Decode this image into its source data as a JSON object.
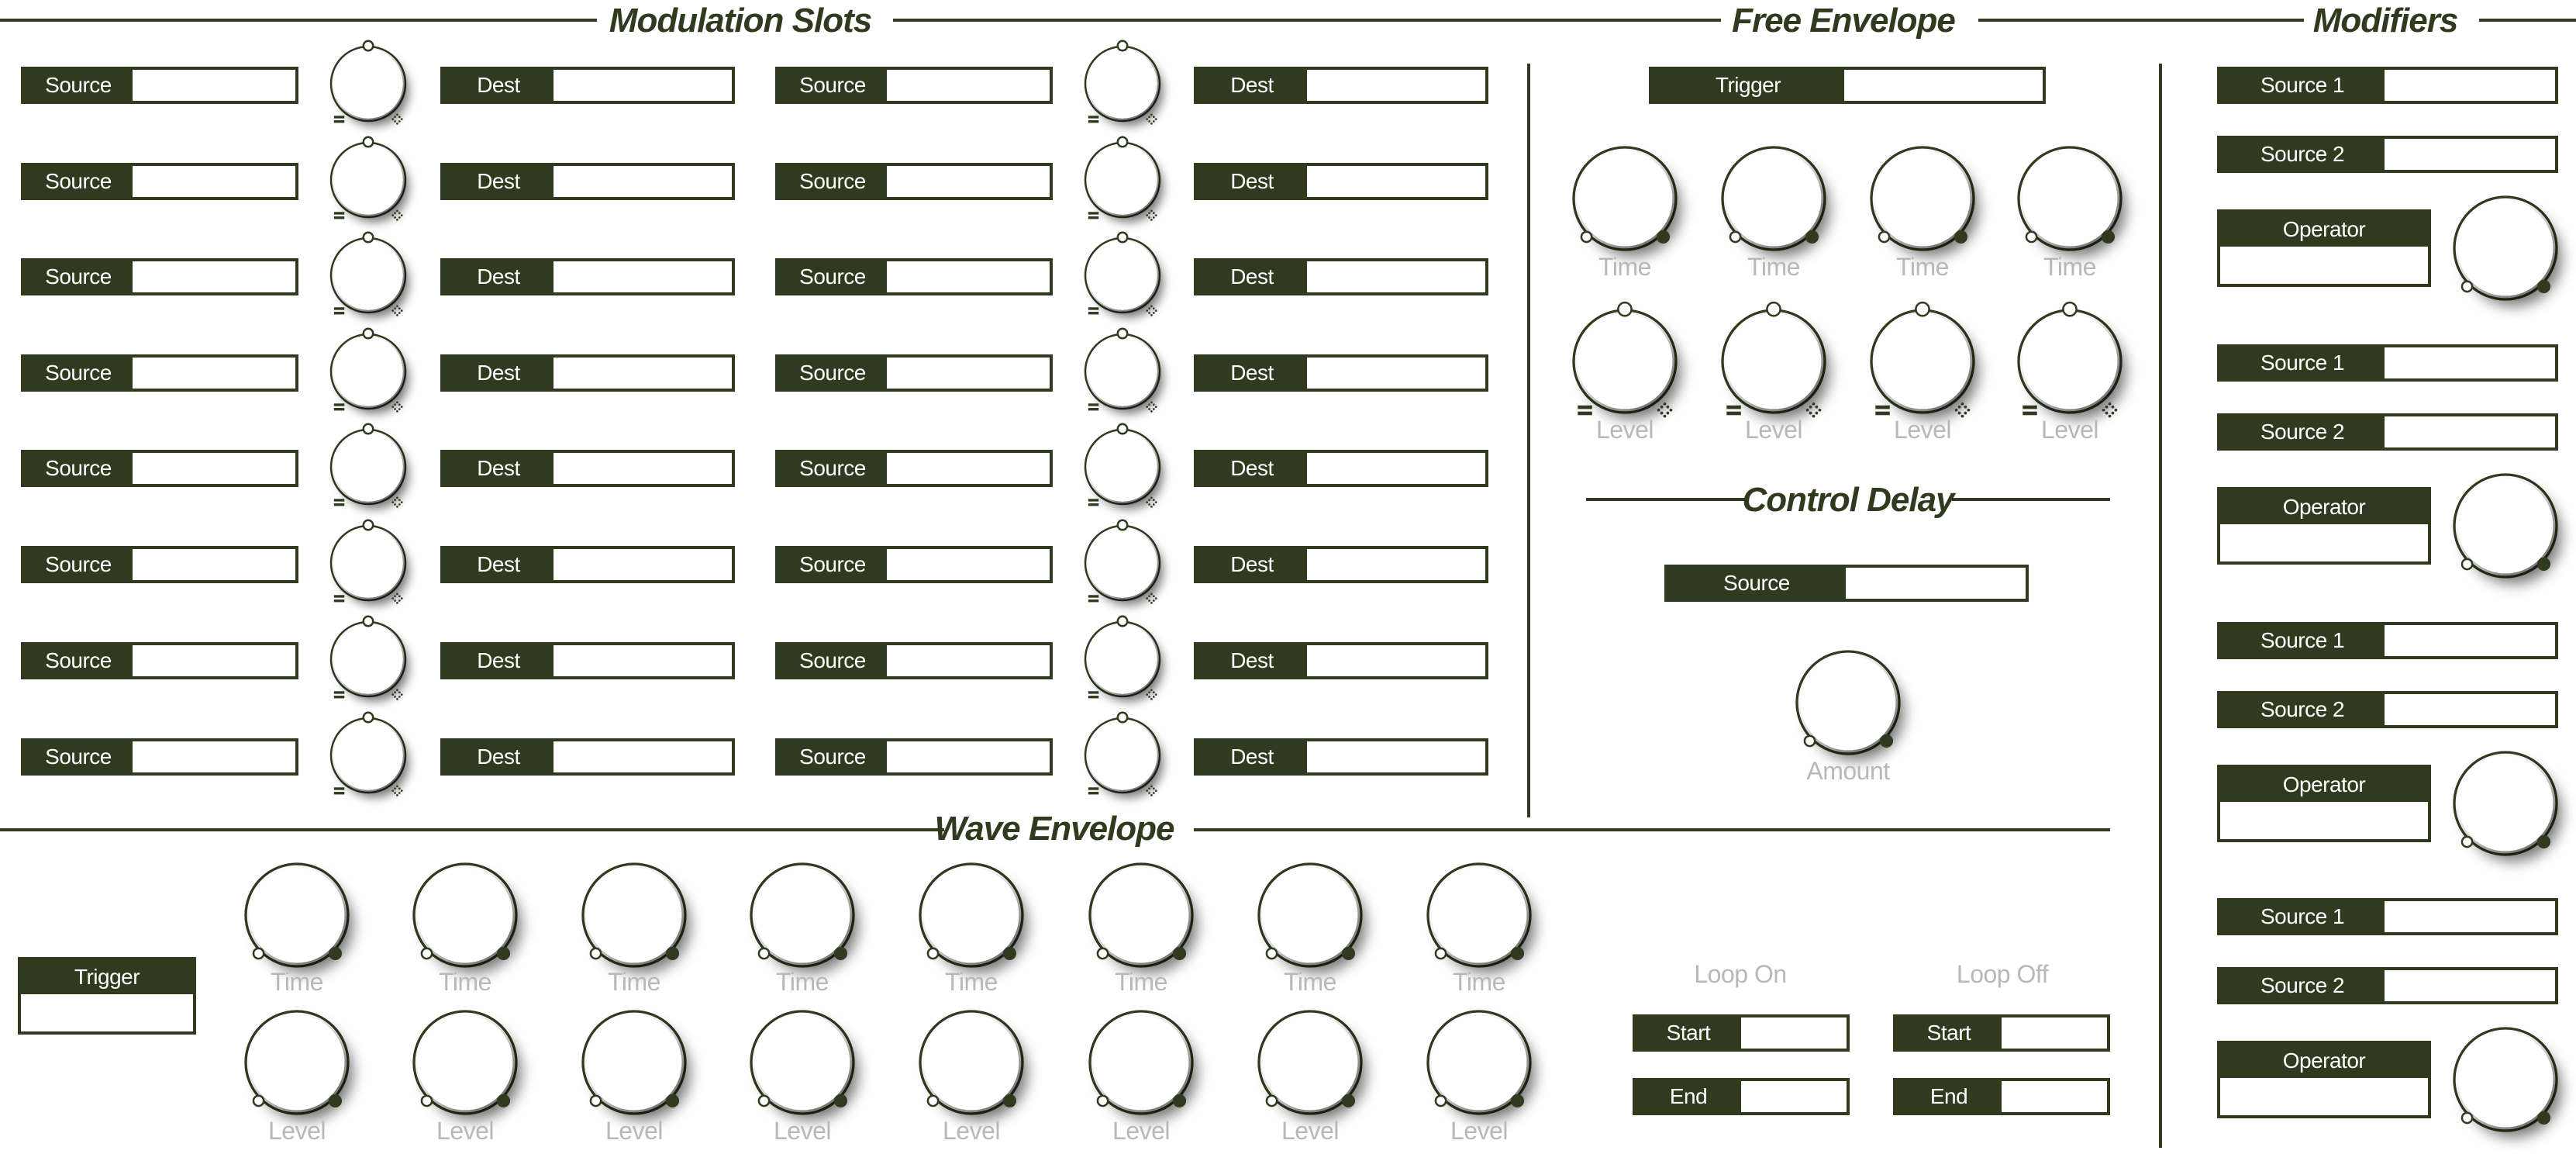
{
  "sections": {
    "modulation_slots": "Modulation Slots",
    "free_envelope": "Free Envelope",
    "modifiers": "Modifiers",
    "control_delay": "Control Delay",
    "wave_envelope": "Wave Envelope"
  },
  "modulation": {
    "source_label": "Source",
    "dest_label": "Dest",
    "rows": 8,
    "columns": 2
  },
  "free_envelope": {
    "trigger_label": "Trigger",
    "time_labels": [
      "Time",
      "Time",
      "Time",
      "Time"
    ],
    "level_labels": [
      "Level",
      "Level",
      "Level",
      "Level"
    ]
  },
  "control_delay": {
    "source_label": "Source",
    "amount_label": "Amount"
  },
  "wave_envelope": {
    "trigger_label": "Trigger",
    "time_labels": [
      "Time",
      "Time",
      "Time",
      "Time",
      "Time",
      "Time",
      "Time",
      "Time"
    ],
    "level_labels": [
      "Level",
      "Level",
      "Level",
      "Level",
      "Level",
      "Level",
      "Level",
      "Level"
    ],
    "loop_on_label": "Loop On",
    "loop_off_label": "Loop Off",
    "start_label": "Start",
    "end_label": "End"
  },
  "modifiers": {
    "items": [
      {
        "source1": "Source 1",
        "source2": "Source 2",
        "operator": "Operator"
      },
      {
        "source1": "Source 1",
        "source2": "Source 2",
        "operator": "Operator"
      },
      {
        "source1": "Source 1",
        "source2": "Source 2",
        "operator": "Operator"
      },
      {
        "source1": "Source 1",
        "source2": "Source 2",
        "operator": "Operator"
      }
    ]
  },
  "colors": {
    "accent": "#2f3a1f",
    "knob_fill": "#ffffff",
    "label_grey": "#b8b8b8"
  }
}
